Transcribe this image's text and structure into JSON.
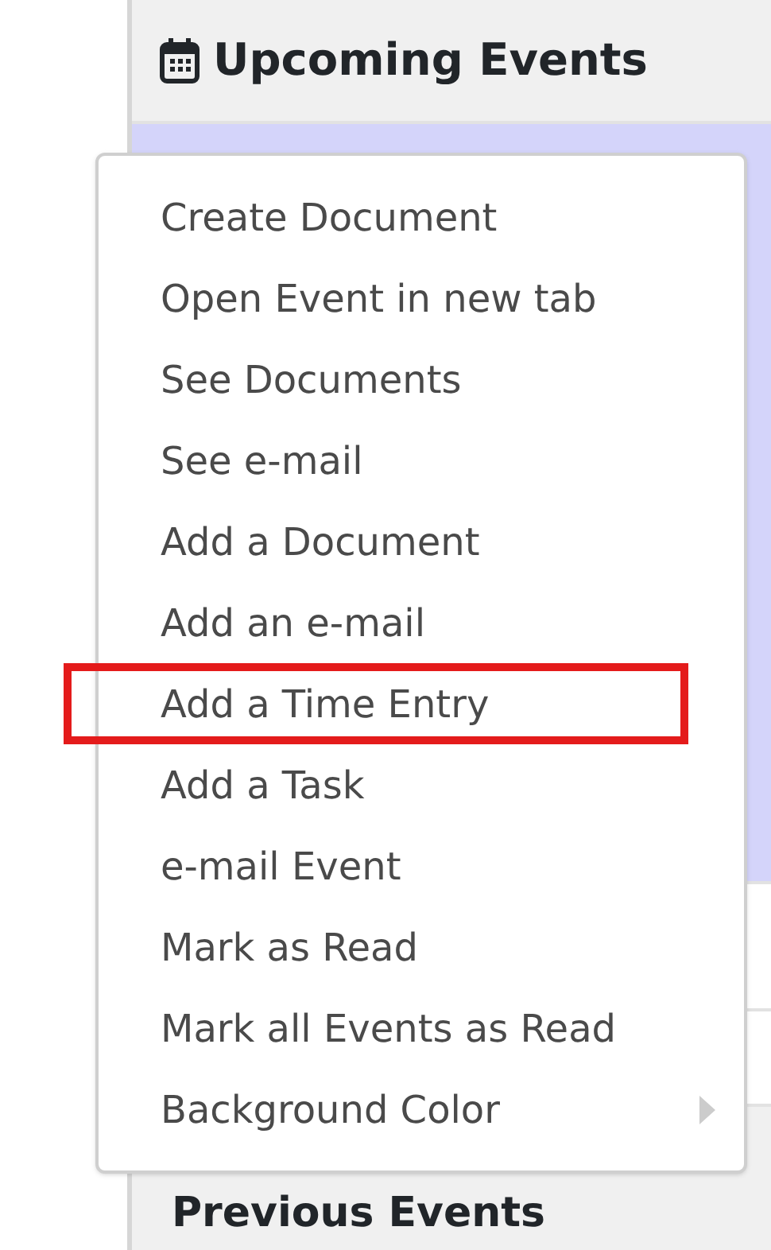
{
  "panel": {
    "title": "Upcoming Events",
    "next_title": "Previous Events"
  },
  "event_rows": [
    {
      "selected": true
    },
    {
      "selected": false
    },
    {
      "selected": false
    }
  ],
  "context_menu": {
    "items": [
      {
        "label": "Create Document",
        "kind": "action",
        "highlighted": false
      },
      {
        "label": "Open Event in new tab",
        "kind": "action",
        "highlighted": false
      },
      {
        "label": "See Documents",
        "kind": "action",
        "highlighted": false
      },
      {
        "label": "See e-mail",
        "kind": "action",
        "highlighted": false
      },
      {
        "label": "Add a Document",
        "kind": "action",
        "highlighted": false
      },
      {
        "label": "Add an e-mail",
        "kind": "action",
        "highlighted": false
      },
      {
        "label": "Add a Time Entry",
        "kind": "action",
        "highlighted": true
      },
      {
        "label": "Add a Task",
        "kind": "action",
        "highlighted": false
      },
      {
        "label": "e-mail Event",
        "kind": "action",
        "highlighted": false
      },
      {
        "label": "Mark as Read",
        "kind": "action",
        "highlighted": false
      },
      {
        "label": "Mark all Events as Read",
        "kind": "action",
        "highlighted": false
      },
      {
        "label": "Background Color",
        "kind": "submenu",
        "highlighted": false
      }
    ]
  }
}
